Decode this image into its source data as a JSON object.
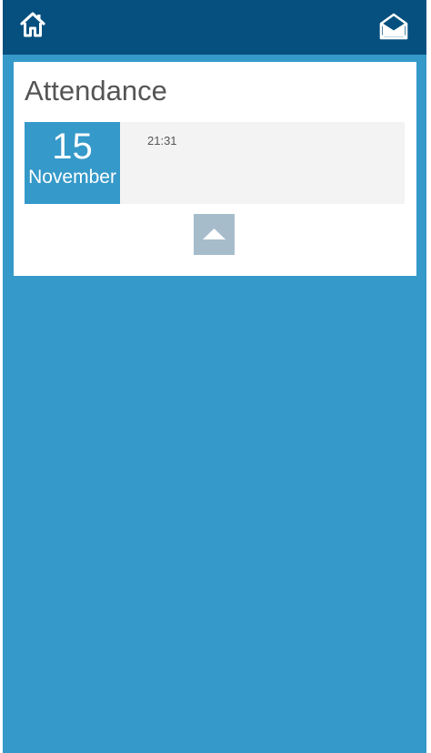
{
  "header": {
    "home_icon": "home-icon",
    "mail_icon": "envelope-open-icon"
  },
  "card": {
    "title": "Attendance",
    "entries": [
      {
        "day": "15",
        "month": "November",
        "time": "21:31"
      }
    ],
    "collapse_icon": "caret-up-icon"
  },
  "colors": {
    "header_bg": "#05507f",
    "page_bg": "#3599c9",
    "date_box_bg": "#3599c9",
    "entry_bg": "#f3f3f3",
    "collapse_button_bg": "#a6bccb"
  }
}
